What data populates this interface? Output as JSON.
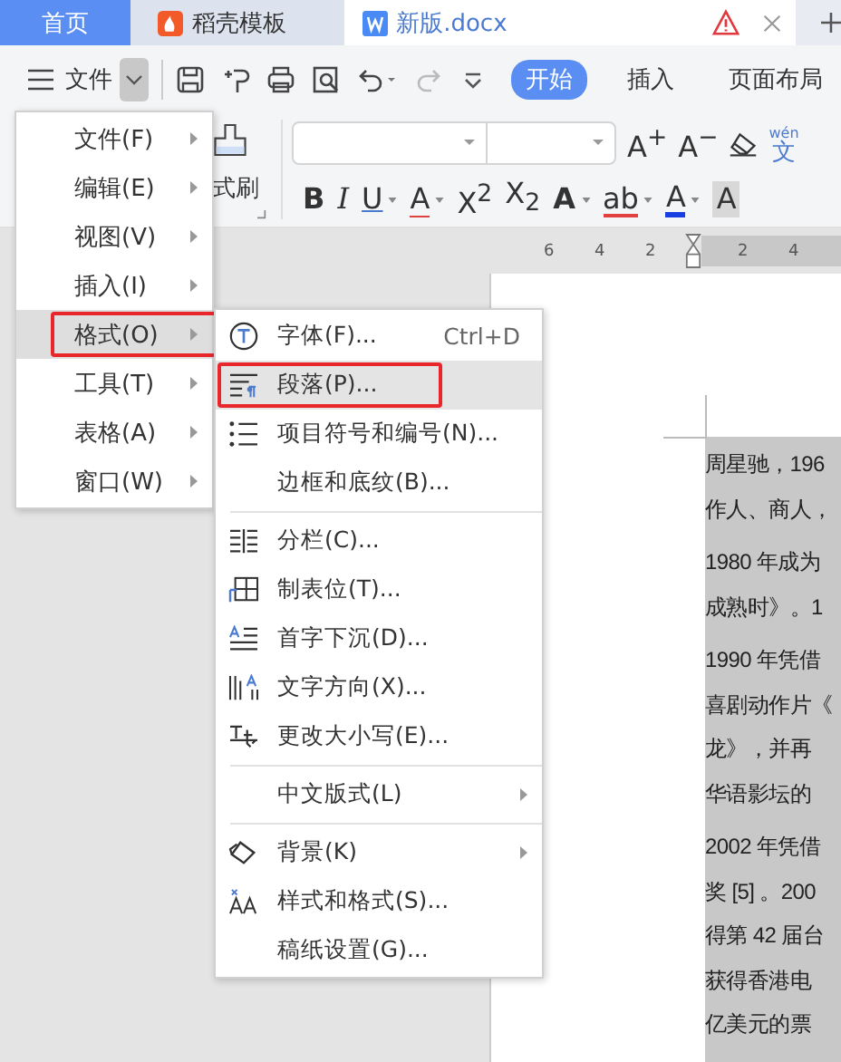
{
  "tabs": [
    {
      "label": "首页",
      "kind": "home",
      "selected": false
    },
    {
      "label": "稻壳模板",
      "kind": "template",
      "selected": false
    },
    {
      "label": "新版.docx",
      "kind": "doc",
      "selected": true
    }
  ],
  "toolbar": {
    "file_menu": {
      "label": "文件",
      "open": true
    },
    "ribbon_tabs": [
      {
        "label": "开始",
        "selected": true
      },
      {
        "label": "插入",
        "selected": false
      },
      {
        "label": "页面布局",
        "selected": false
      }
    ]
  },
  "ribbon": {
    "format_painter": "式刷",
    "row_1": [
      {
        "kind": "grow",
        "label": "A$^{+}$"
      },
      {
        "kind": "shrink",
        "label": "A$^{−}$"
      },
      {
        "kind": "eraser"
      },
      {
        "kind": "phonetic",
        "label": "文",
        "ruby": "wén"
      }
    ],
    "row_2": [
      {
        "kind": "bold",
        "label": "B",
        "caret": false
      },
      {
        "kind": "italic",
        "label": "I",
        "caret": false
      },
      {
        "kind": "underline",
        "label": "U",
        "caret": true
      },
      {
        "kind": "strike",
        "label": "A",
        "caret": true
      },
      {
        "kind": "plain",
        "label": "X$^{2}$",
        "caret": false
      },
      {
        "kind": "plain",
        "label": "X$_{2}$",
        "caret": false
      },
      {
        "kind": "outline",
        "label": "A",
        "caret": true
      },
      {
        "kind": "highlight",
        "label": "ab",
        "caret": true
      },
      {
        "kind": "fontcolor",
        "label": "A",
        "caret": true
      },
      {
        "kind": "shade",
        "label": "A",
        "caret": false
      }
    ]
  },
  "ruler": {
    "ticks": [
      "6",
      "4",
      "2",
      "2",
      "4"
    ]
  },
  "main_menu": [
    {
      "label": "文件(F)",
      "submenu": true,
      "selected": false,
      "annotated": false
    },
    {
      "label": "编辑(E)",
      "submenu": true,
      "selected": false,
      "annotated": false
    },
    {
      "label": "视图(V)",
      "submenu": true,
      "selected": false,
      "annotated": false
    },
    {
      "label": "插入(I)",
      "submenu": true,
      "selected": false,
      "annotated": false
    },
    {
      "label": "格式(O)",
      "submenu": true,
      "selected": true,
      "annotated": true
    },
    {
      "label": "工具(T)",
      "submenu": true,
      "selected": false,
      "annotated": false
    },
    {
      "label": "表格(A)",
      "submenu": true,
      "selected": false,
      "annotated": false
    },
    {
      "label": "窗口(W)",
      "submenu": true,
      "selected": false,
      "annotated": false
    }
  ],
  "format_submenu": [
    [
      {
        "label": "字体(F)...",
        "shortcut": "Ctrl+D",
        "submenu": false,
        "selected": false,
        "annotated": false
      },
      {
        "label": "段落(P)...",
        "submenu": false,
        "selected": true,
        "annotated": true
      },
      {
        "label": "项目符号和编号(N)...",
        "submenu": false,
        "selected": false,
        "annotated": false
      },
      {
        "label": "边框和底纹(B)...",
        "submenu": false,
        "selected": false,
        "annotated": false
      }
    ],
    [
      {
        "label": "分栏(C)...",
        "submenu": false,
        "selected": false,
        "annotated": false
      },
      {
        "label": "制表位(T)...",
        "submenu": false,
        "selected": false,
        "annotated": false
      },
      {
        "label": "首字下沉(D)...",
        "submenu": false,
        "selected": false,
        "annotated": false
      },
      {
        "label": "文字方向(X)...",
        "submenu": false,
        "selected": false,
        "annotated": false
      },
      {
        "label": "更改大小写(E)...",
        "submenu": false,
        "selected": false,
        "annotated": false
      }
    ],
    [
      {
        "label": "中文版式(L)",
        "submenu": true,
        "selected": false,
        "annotated": false
      }
    ],
    [
      {
        "label": "背景(K)",
        "submenu": true,
        "selected": false,
        "annotated": false
      },
      {
        "label": "样式和格式(S)...",
        "submenu": false,
        "selected": false,
        "annotated": false
      },
      {
        "label": "稿纸设置(G)...",
        "submenu": false,
        "selected": false,
        "annotated": false
      }
    ]
  ],
  "document": {
    "paragraphs": [
      [
        "周星驰，196",
        "作人、商人，"
      ],
      [
        "1980 年成为",
        "成熟时》。1"
      ],
      [
        "1990 年凭借",
        "喜剧动作片《",
        "龙》，并再",
        "华语影坛的"
      ],
      [
        "2002 年凭借",
        "奖 [5] 。200",
        "得第 42 届台",
        "获得香港电",
        "亿美元的票"
      ]
    ]
  }
}
